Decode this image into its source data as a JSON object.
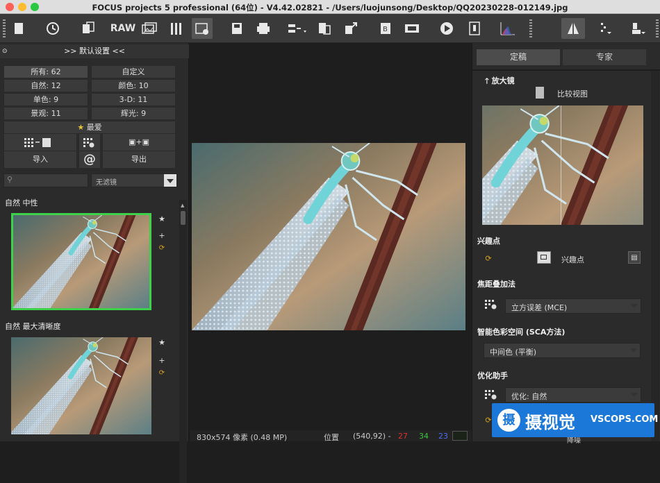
{
  "window": {
    "title": "FOCUS projects 5 professional (64位) - V4.42.02821 - /Users/luojunsong/Desktop/QQ20230228-012149.jpg"
  },
  "toolbar": {
    "raw_label": "RAW"
  },
  "left": {
    "header": ">> 默认设置 <<",
    "filters": {
      "all": "所有: 62",
      "custom": "自定义",
      "natural": "自然: 12",
      "color": "颜色: 10",
      "mono": "单色: 9",
      "three_d": "3-D: 11",
      "landscape": "景观: 11",
      "glow": "辉光: 9"
    },
    "favorites": "最爱",
    "import": "导入",
    "export": "导出",
    "at_symbol": "@",
    "filter_select": "无滤镜",
    "presets": [
      {
        "label": "自然 中性"
      },
      {
        "label": "自然 最大清晰度"
      }
    ]
  },
  "status": {
    "size": "830x574 像素 (0.48 MP)",
    "position_label": "位置",
    "coords": "(540,92) -",
    "r": "27",
    "g": "34",
    "b": "23"
  },
  "right": {
    "tabs": [
      "定稿",
      "专家"
    ],
    "magnifier": "放大镜",
    "compare": "比较视图",
    "poi_section": "兴趣点",
    "poi_button": "兴趣点",
    "stack_section": "焦距叠加法",
    "stack_value": "立方误差 (MCE)",
    "sca_section": "智能色彩空间 (SCA方法)",
    "sca_value": "中间色 (平衡)",
    "assist_section": "优化助手",
    "assist_value": "优化: 自然",
    "bottom_label": "降噪"
  },
  "watermark": {
    "cn": "摄视觉",
    "en": "VSCOPS.COM",
    "glyph": "摄"
  },
  "colors": {
    "green_frame": "#3ed24b",
    "status_red": "#e03131",
    "status_green": "#37c837",
    "status_blue": "#4c6ef5",
    "brand": "#1b78d8"
  }
}
